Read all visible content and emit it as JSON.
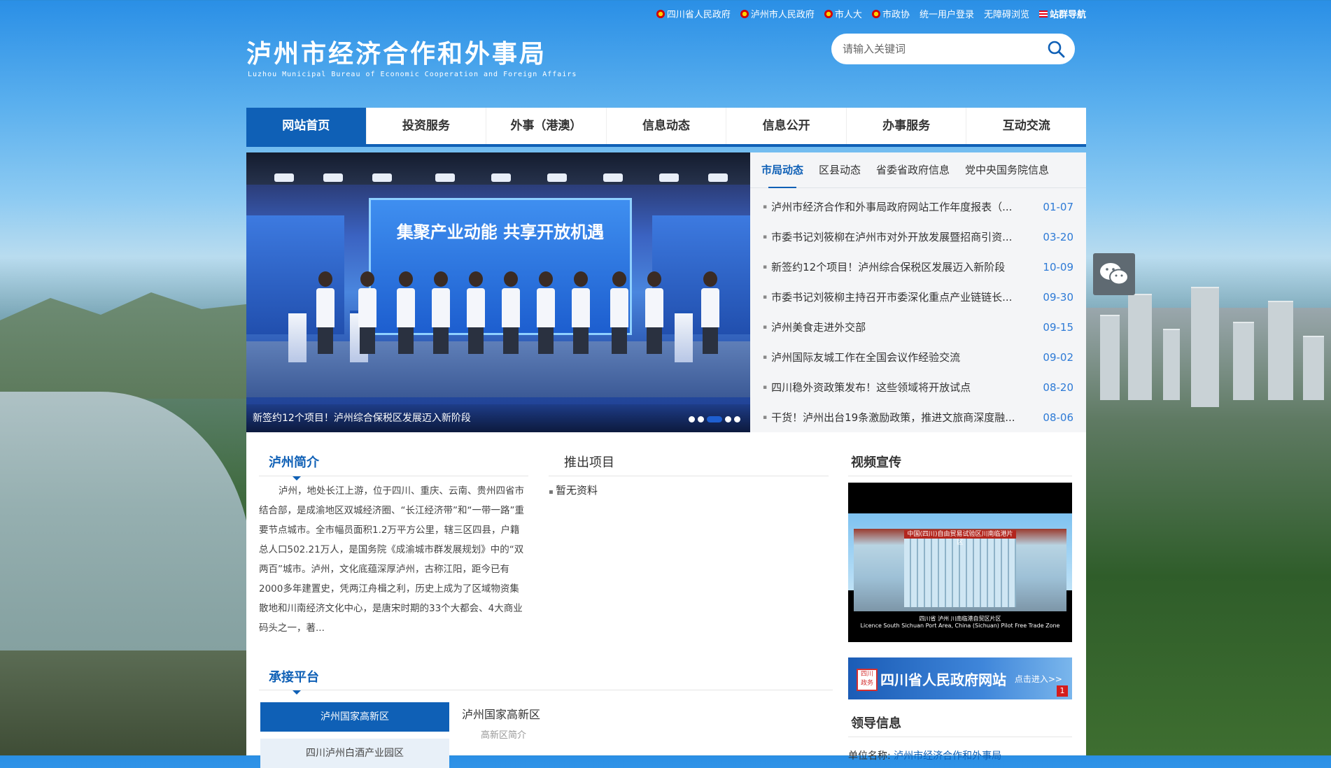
{
  "top_links": [
    {
      "label": "四川省人民政府",
      "icon": "emblem-icon"
    },
    {
      "label": "泸州市人民政府",
      "icon": "emblem-icon"
    },
    {
      "label": "市人大",
      "icon": "emblem-icon"
    },
    {
      "label": "市政协",
      "icon": "emblem-icon"
    },
    {
      "label": "统一用户登录"
    },
    {
      "label": "无障碍浏览"
    },
    {
      "label": "站群导航",
      "icon": "flag-icon"
    }
  ],
  "header": {
    "title": "泸州市经济合作和外事局",
    "subtitle": "Luzhou Municipal Bureau of Economic Cooperation and Foreign Affairs"
  },
  "search": {
    "placeholder": "请输入关键词",
    "value": ""
  },
  "nav": {
    "items": [
      {
        "label": "网站首页",
        "active": true
      },
      {
        "label": "投资服务"
      },
      {
        "label": "外事（港澳）"
      },
      {
        "label": "信息动态"
      },
      {
        "label": "信息公开"
      },
      {
        "label": "办事服务"
      },
      {
        "label": "互动交流"
      }
    ]
  },
  "banner": {
    "caption": "新签约12个项目！泸州综合保税区发展迈入新阶段",
    "screen_title": "集聚产业动能  共享开放机遇",
    "slide_count": 5,
    "active_slide": 3
  },
  "news": {
    "tabs": [
      {
        "label": "市局动态",
        "active": true
      },
      {
        "label": "区县动态"
      },
      {
        "label": "省委省政府信息"
      },
      {
        "label": "党中央国务院信息"
      }
    ],
    "items": [
      {
        "title": "泸州市经济合作和外事局政府网站工作年度报表（...",
        "date": "01-07"
      },
      {
        "title": "市委书记刘筱柳在泸州市对外开放发展暨招商引资...",
        "date": "03-20"
      },
      {
        "title": "新签约12个项目！泸州综合保税区发展迈入新阶段",
        "date": "10-09"
      },
      {
        "title": "市委书记刘筱柳主持召开市委深化重点产业链链长...",
        "date": "09-30"
      },
      {
        "title": "泸州美食走进外交部",
        "date": "09-15"
      },
      {
        "title": "泸州国际友城工作在全国会议作经验交流",
        "date": "09-02"
      },
      {
        "title": "四川稳外资政策发布！这些领域将开放试点",
        "date": "08-20"
      },
      {
        "title": "干货！泸州出台19条激励政策，推进文旅商深度融...",
        "date": "08-06"
      }
    ]
  },
  "intro": {
    "title": "泸州简介",
    "text": "泸州，地处长江上游，位于四川、重庆、云南、贵州四省市结合部，是成渝地区双城经济圈、“长江经济带”和“一带一路”重要节点城市。全市幅员面积1.2万平方公里，辖三区四县，户籍总人口502.21万人，是国务院《成渝城市群发展规划》中的“双两百”城市。泸州，文化底蕴深厚泸州，古称江阳，距今已有2000多年建置史，凭两江舟楫之利，历史上成为了区域物资集散地和川南经济文化中心，是唐宋时期的33个大都会、4大商业码头之一，著..."
  },
  "projects": {
    "title": "推出项目",
    "empty": "暂无资料"
  },
  "video": {
    "title": "视频宣传",
    "sign_text": "中国(四川)自由贸易试验区川南临港片区",
    "caption_cn": "四川省 泸州  川南临港自贸区片区",
    "caption_en": "Licence South Sichuan Port Area, China (Sichuan) Pilot Free Trade Zone"
  },
  "gov_banner": {
    "seal": "四川政务",
    "label": "四川省人民政府网站",
    "enter": "点击进入>>",
    "badge": "1"
  },
  "leaders": {
    "title": "领导信息",
    "unit_label": "单位名称:",
    "unit_value": "泸州市经济合作和外事局"
  },
  "platform": {
    "title": "承接平台",
    "tabs": [
      {
        "label": "泸州国家高新区",
        "active": true
      },
      {
        "label": "四川泸州白酒产业园区"
      }
    ],
    "detail_title": "泸州国家高新区",
    "detail_sub": "高新区简介"
  },
  "colors": {
    "brand": "#0f60b6",
    "date": "#2d7ad6"
  }
}
